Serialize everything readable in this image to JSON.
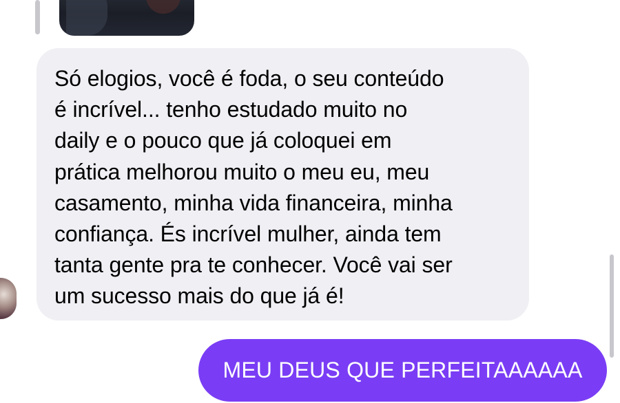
{
  "conversation": {
    "incoming_message": {
      "lines": [
        "Só elogios, você é foda, o seu conteúdo",
        "é incrível... tenho estudado muito no",
        "daily e o pouco que já coloquei em",
        "prática melhorou muito o meu eu, meu",
        "casamento, minha vida financeira, minha",
        "confiança. És incrível mulher, ainda tem",
        "tanta gente pra te conhecer. Você vai ser",
        "um sucesso mais do que já é!"
      ]
    },
    "outgoing_message": {
      "text": "MEU DEUS QUE PERFEITAAAAAA"
    }
  },
  "colors": {
    "incoming_bubble": "#efeff4",
    "outgoing_bubble": "#7a3df5",
    "outgoing_text": "#ffffff",
    "background": "#ffffff"
  },
  "icons": {
    "avatar": "user-avatar-photo",
    "attachment": "image-attachment-thumbnail"
  }
}
